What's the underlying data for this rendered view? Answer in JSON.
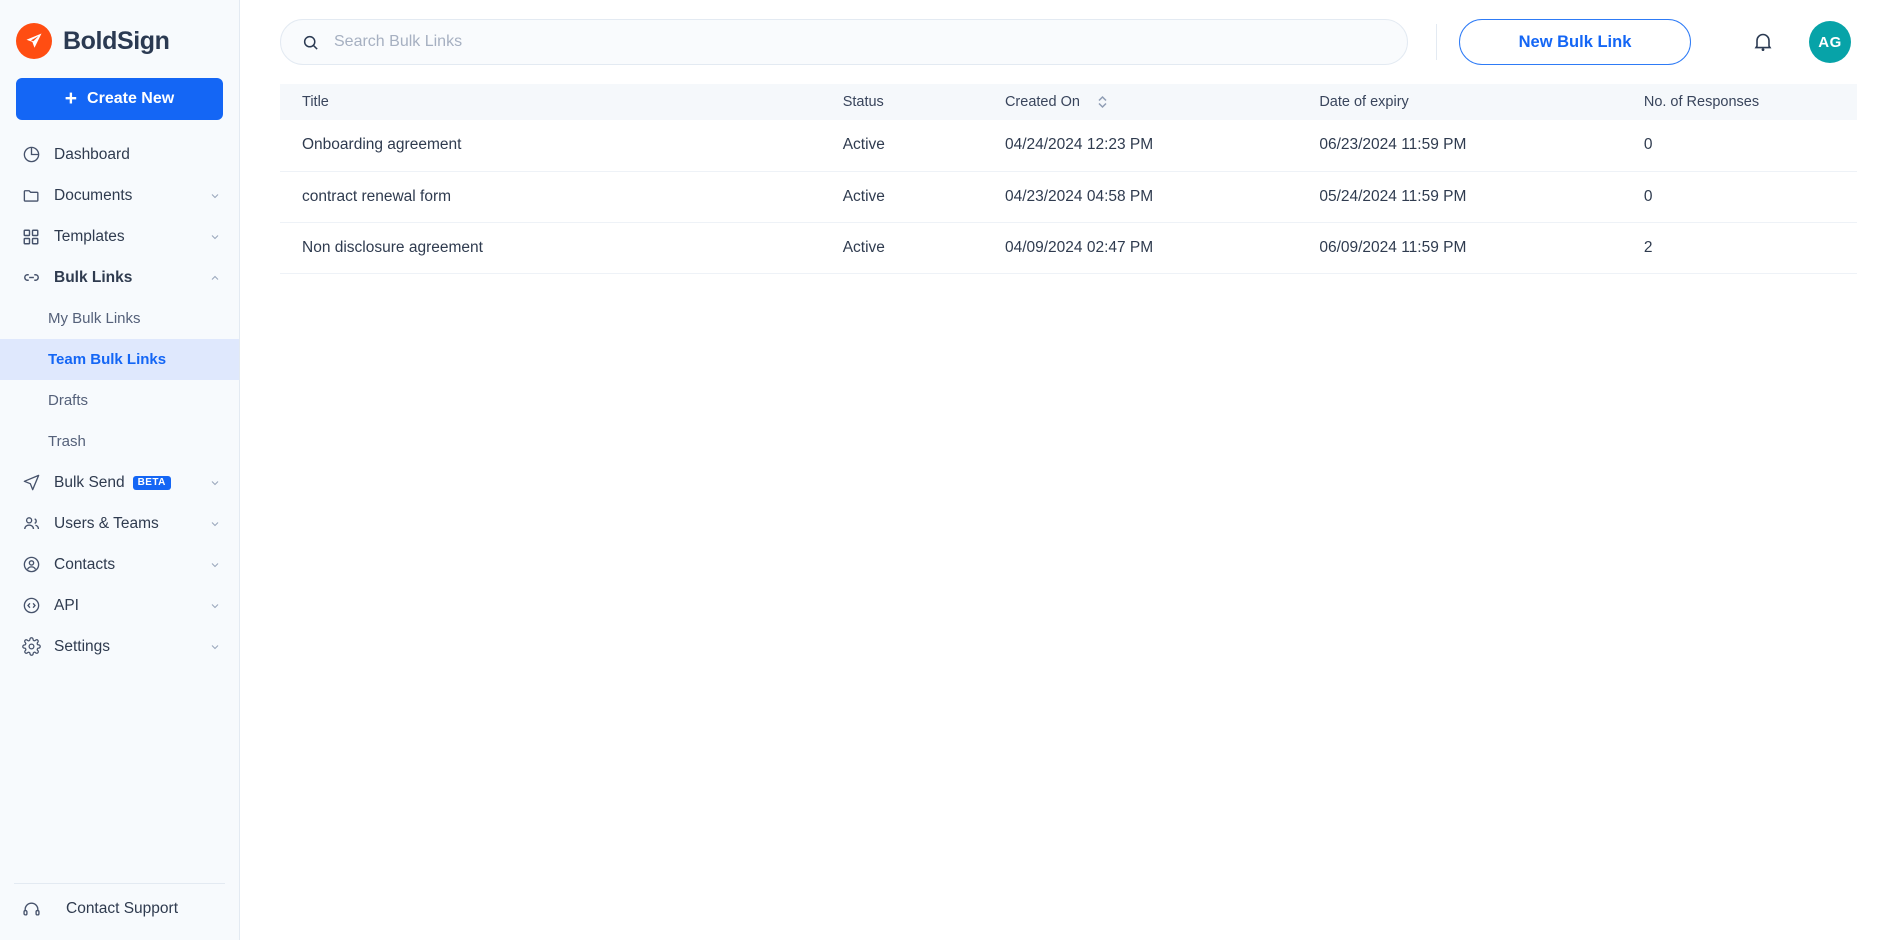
{
  "brand": {
    "name": "BoldSign",
    "logo_icon": "boldsign-paper-plane-logo",
    "logo_color": "#ff4d12"
  },
  "sidebar": {
    "create_button": {
      "label": "Create New",
      "icon": "plus-icon",
      "color": "#1466f5"
    },
    "items": [
      {
        "label": "Dashboard",
        "icon": "pie-chart-icon",
        "expandable": false,
        "bold": false
      },
      {
        "label": "Documents",
        "icon": "folder-icon",
        "expandable": true,
        "bold": false
      },
      {
        "label": "Templates",
        "icon": "grid-icon",
        "expandable": true,
        "bold": false
      },
      {
        "label": "Bulk Links",
        "icon": "link-icon",
        "expandable": true,
        "expanded": true,
        "bold": true
      },
      {
        "label": "Bulk Send",
        "icon": "paper-plane-icon",
        "expandable": true,
        "bold": false,
        "badge": "BETA"
      },
      {
        "label": "Users & Teams",
        "icon": "users-icon",
        "expandable": true,
        "bold": false
      },
      {
        "label": "Contacts",
        "icon": "contact-person-icon",
        "expandable": true,
        "bold": false
      },
      {
        "label": "API",
        "icon": "code-icon",
        "expandable": true,
        "bold": false
      },
      {
        "label": "Settings",
        "icon": "gear-icon",
        "expandable": true,
        "bold": false
      }
    ],
    "bulk_links_children": [
      {
        "label": "My Bulk Links",
        "active": false
      },
      {
        "label": "Team Bulk Links",
        "active": true
      },
      {
        "label": "Drafts",
        "active": false
      },
      {
        "label": "Trash",
        "active": false
      }
    ],
    "active_item": "Team Bulk Links",
    "active_color": "#1466f5",
    "support": {
      "label": "Contact Support",
      "icon": "headset-icon"
    }
  },
  "topbar": {
    "search": {
      "placeholder": "Search Bulk Links",
      "value": "",
      "icon": "search-icon"
    },
    "new_bulk_link_button": {
      "label": "New Bulk Link"
    },
    "notifications": {
      "icon": "bell-icon"
    },
    "avatar": {
      "initials": "AG",
      "color": "#07a3a8"
    }
  },
  "table": {
    "columns": [
      {
        "key": "title",
        "label": "Title",
        "sortable": false
      },
      {
        "key": "status",
        "label": "Status",
        "sortable": false
      },
      {
        "key": "created_on",
        "label": "Created On",
        "sortable": true
      },
      {
        "key": "date_of_expiry",
        "label": "Date of expiry",
        "sortable": false
      },
      {
        "key": "responses",
        "label": "No. of Responses",
        "sortable": false
      }
    ],
    "rows": [
      {
        "title": "Onboarding agreement",
        "status": "Active",
        "created_on": "04/24/2024 12:23 PM",
        "date_of_expiry": "06/23/2024 11:59 PM",
        "responses": "0"
      },
      {
        "title": "contract renewal form",
        "status": "Active",
        "created_on": "04/23/2024 04:58 PM",
        "date_of_expiry": "05/24/2024 11:59 PM",
        "responses": "0"
      },
      {
        "title": "Non disclosure agreement",
        "status": "Active",
        "created_on": "04/09/2024 02:47 PM",
        "date_of_expiry": "06/09/2024 11:59 PM",
        "responses": "2"
      }
    ],
    "status_color_active": "#1f9254"
  }
}
